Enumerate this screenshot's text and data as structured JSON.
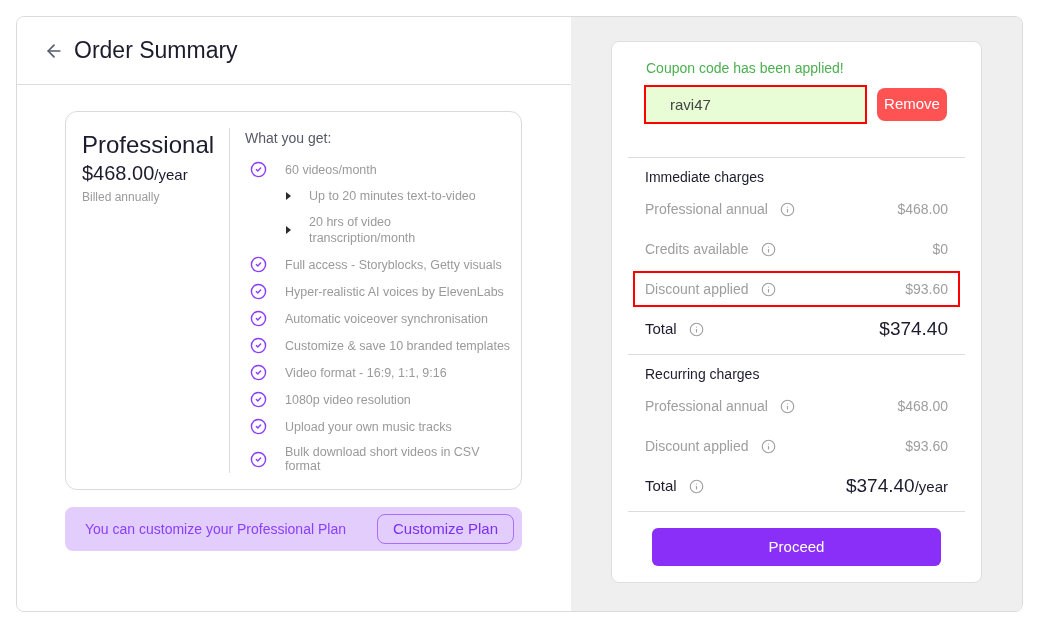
{
  "header": {
    "title": "Order Summary"
  },
  "plan": {
    "name": "Professional",
    "price": "$468.00",
    "period": "/year",
    "billing": "Billed annually",
    "features_title": "What you get:",
    "features": [
      {
        "text": "60 videos/month",
        "children": [
          {
            "text": "Up to 20 minutes text-to-video"
          },
          {
            "text": "20 hrs of video transcription/month"
          }
        ]
      },
      {
        "text": "Full access - Storyblocks, Getty visuals"
      },
      {
        "text": "Hyper-realistic AI voices by ElevenLabs"
      },
      {
        "text": "Automatic voiceover synchronisation"
      },
      {
        "text": "Customize & save 10 branded templates"
      },
      {
        "text": "Video format - 16:9, 1:1, 9:16"
      },
      {
        "text": "1080p video resolution"
      },
      {
        "text": "Upload your own music tracks"
      },
      {
        "text": "Bulk download short videos in CSV format"
      }
    ]
  },
  "customize_banner": {
    "text": "You can customize your Professional Plan",
    "button": "Customize Plan"
  },
  "coupon": {
    "message": "Coupon code has been applied!",
    "value": "ravi47",
    "highlighted": true,
    "button": "Remove"
  },
  "sections": [
    {
      "title": "Immediate charges",
      "rows": [
        {
          "kind": "line",
          "label": "Professional annual",
          "amount": "$468.00",
          "highlighted": false
        },
        {
          "kind": "line",
          "label": "Credits available",
          "amount": "$0",
          "highlighted": false
        },
        {
          "kind": "line",
          "label": "Discount applied",
          "amount": "$93.60",
          "highlighted": true
        },
        {
          "kind": "total",
          "label": "Total",
          "amount": "$374.40",
          "highlighted": false
        }
      ]
    },
    {
      "title": "Recurring charges",
      "rows": [
        {
          "kind": "line",
          "label": "Professional annual",
          "amount": "$468.00",
          "highlighted": false
        },
        {
          "kind": "line",
          "label": "Discount applied",
          "amount": "$93.60",
          "highlighted": false
        },
        {
          "kind": "total",
          "label": "Total",
          "amount": "$374.40",
          "period": "/year",
          "highlighted": false
        }
      ]
    }
  ],
  "proceed_button": "Proceed"
}
